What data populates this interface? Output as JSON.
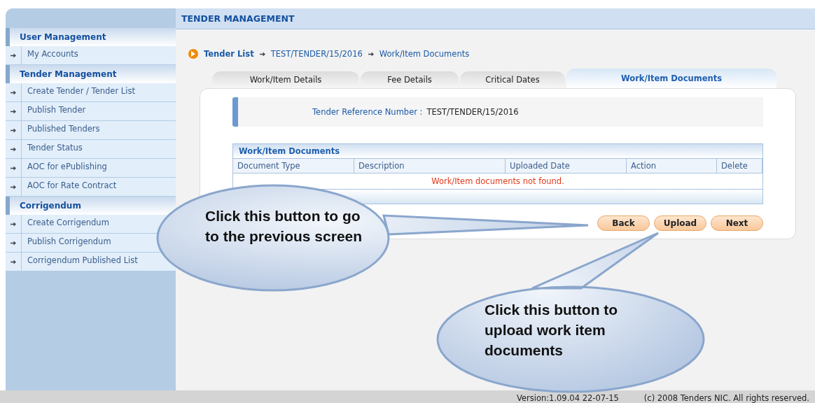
{
  "header": {
    "title": "TENDER MANAGEMENT"
  },
  "sidebar": {
    "sections": [
      {
        "title": "User Management",
        "items": [
          {
            "label": "My Accounts"
          }
        ]
      },
      {
        "title": "Tender Management",
        "items": [
          {
            "label": "Create Tender / Tender List"
          },
          {
            "label": "Publish Tender"
          },
          {
            "label": "Published Tenders"
          },
          {
            "label": "Tender Status"
          },
          {
            "label": "AOC for ePublishing"
          },
          {
            "label": "AOC for Rate Contract"
          }
        ]
      },
      {
        "title": "Corrigendum",
        "items": [
          {
            "label": "Create Corrigendum"
          },
          {
            "label": "Publish Corrigendum"
          },
          {
            "label": "Corrigendum Published List"
          }
        ]
      }
    ]
  },
  "breadcrumb": [
    "Tender List",
    "TEST/TENDER/15/2016",
    "Work/Item Documents"
  ],
  "tabs": [
    {
      "label": "Work/Item Details",
      "selected": false
    },
    {
      "label": "Fee Details",
      "selected": false
    },
    {
      "label": "Critical Dates",
      "selected": false
    },
    {
      "label": "Work/Item Documents",
      "selected": true
    }
  ],
  "reference": {
    "label": "Tender Reference Number :",
    "value": "TEST/TENDER/15/2016"
  },
  "table": {
    "title": "Work/Item Documents",
    "columns": [
      "Document Type",
      "Description",
      "Uploaded Date",
      "Action",
      "Delete"
    ],
    "empty_message": "Work/Item documents not found."
  },
  "buttons": [
    "Back",
    "Upload",
    "Next"
  ],
  "callouts": [
    {
      "text": "Click this button to go to the previous screen"
    },
    {
      "text": "Click this button to upload work item documents"
    }
  ],
  "footer": {
    "version": "Version:1.09.04 22-07-15",
    "copyright": "(c) 2008 Tenders NIC. All rights reserved."
  }
}
